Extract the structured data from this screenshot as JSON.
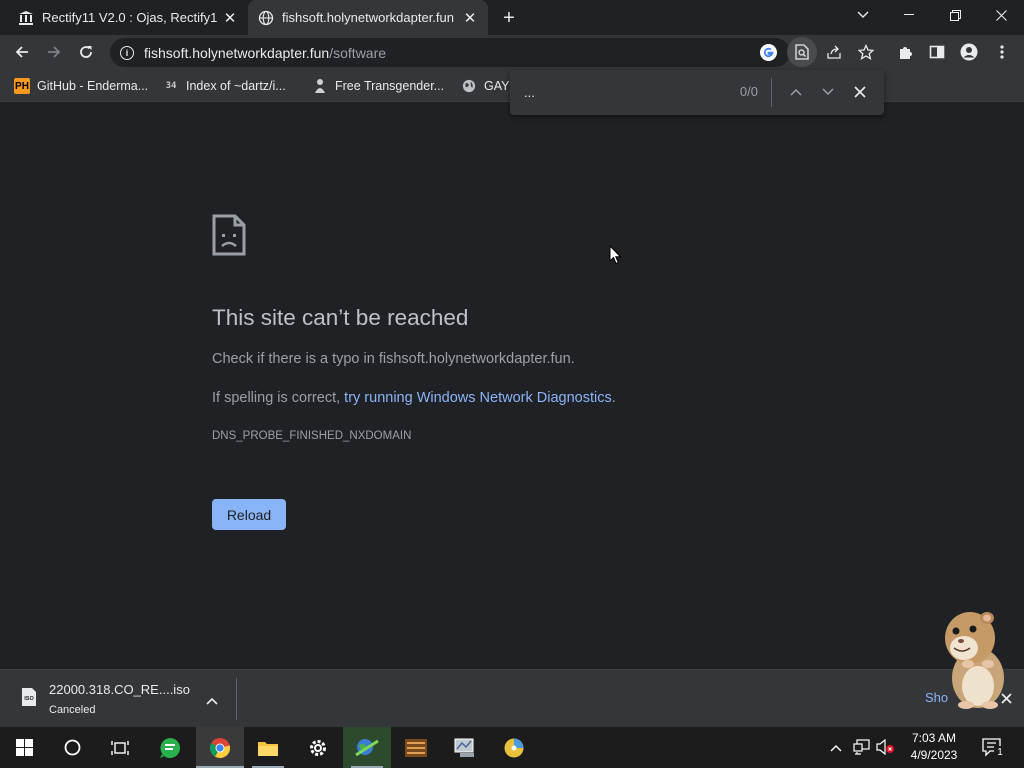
{
  "tabs": [
    {
      "title": "Rectify11 V2.0 : Ojas, Rectify1",
      "active": false,
      "icon": "bank-icon"
    },
    {
      "title": "fishsoft.holynetworkdapter.fun",
      "active": true,
      "icon": "globe-icon"
    }
  ],
  "toolbar": {
    "url_host": "fishsoft.holynetworkdapter.fun",
    "url_path": "/software"
  },
  "bookmarks": [
    {
      "label": "GitHub - Enderma...",
      "icon": "ph-icon",
      "badge": "PH"
    },
    {
      "label": "Index of ~dartz/i...",
      "icon": "ascii-art-icon",
      "badge": "34"
    },
    {
      "label": "Free Transgender...",
      "icon": "figure-icon"
    },
    {
      "label": "GAY",
      "icon": "globe-icon"
    }
  ],
  "find_bar": {
    "query": "...",
    "count": "0/0"
  },
  "error_page": {
    "title": "This site can’t be reached",
    "line1": "Check if there is a typo in fishsoft.holynetworkdapter.fun.",
    "line2_prefix": "If spelling is correct, ",
    "line2_link": "try running Windows Network Diagnostics",
    "line2_suffix": ".",
    "code": "DNS_PROBE_FINISHED_NXDOMAIN",
    "reload_label": "Reload"
  },
  "downloads": {
    "file_name": "22000.318.CO_RE....iso",
    "status": "Canceled",
    "show_all": "Sho"
  },
  "taskbar": {
    "apps": [
      "start-icon",
      "cortana-icon",
      "task-view-icon",
      "chat-app-icon",
      "chrome-icon",
      "file-explorer-icon",
      "settings-icon",
      "network-tool-icon",
      "archive-app-icon",
      "device-manager-icon",
      "disc-app-icon"
    ],
    "time": "7:03 AM",
    "date": "4/9/2023",
    "notification_count": "1"
  },
  "colors": {
    "accent": "#8ab4f8",
    "background": "#202124",
    "toolbar": "#35363a"
  }
}
